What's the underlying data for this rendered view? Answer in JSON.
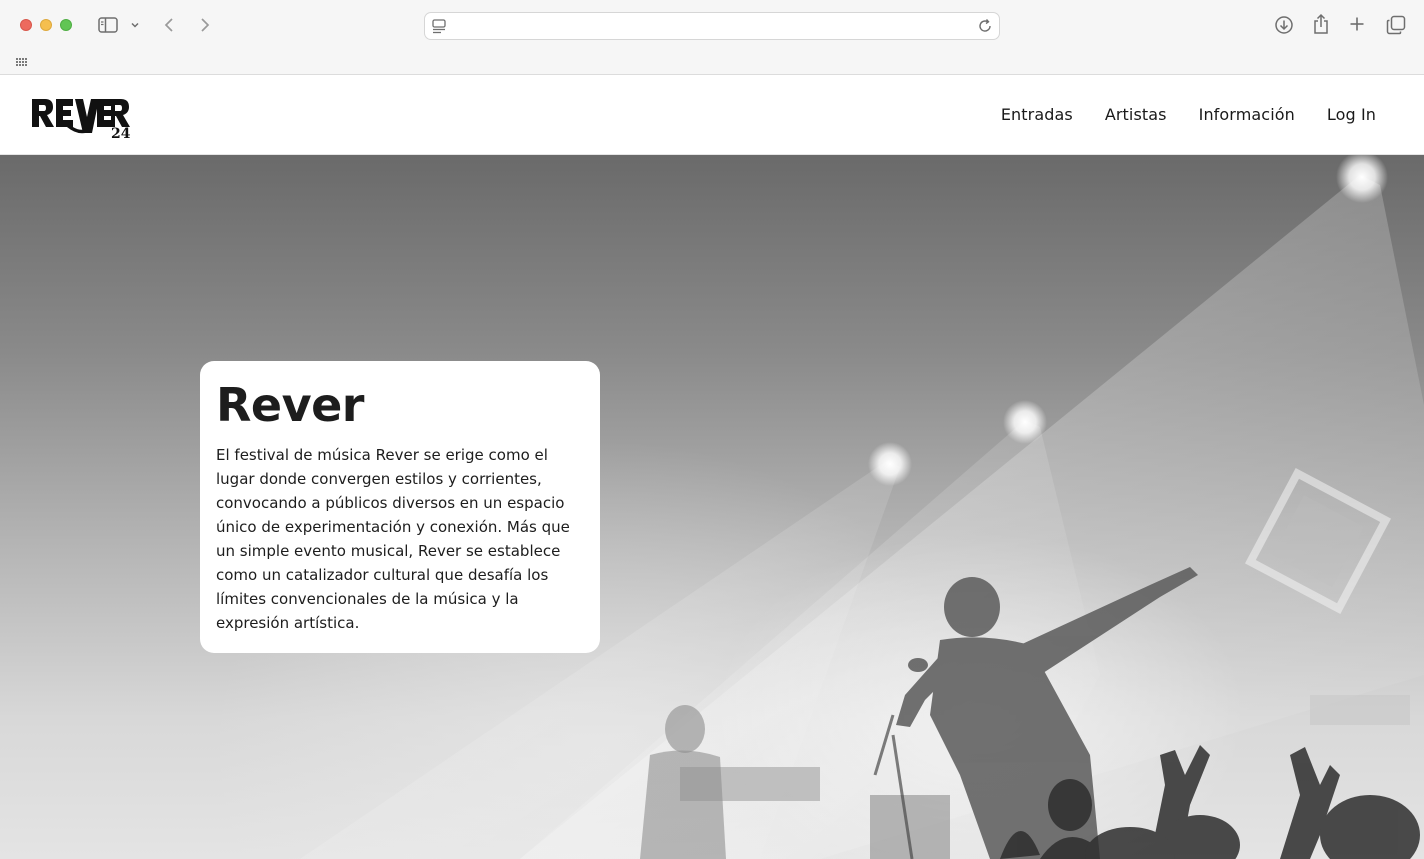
{
  "browser": {
    "icons": {
      "sidebar": "sidebar-icon",
      "chevron": "chevron-down-icon",
      "back": "back-arrow-icon",
      "forward": "forward-arrow-icon",
      "page": "page-icon",
      "reload": "reload-icon",
      "download": "download-icon",
      "share": "share-icon",
      "new_tab": "plus-icon",
      "tabs": "tab-overview-icon",
      "favorites": "grid-icon"
    },
    "colors": {
      "close": "#ed6a5e",
      "minimize": "#f5bf4f",
      "zoom": "#61c554"
    }
  },
  "site": {
    "logo_text": "REVER 24",
    "nav": [
      {
        "label": "Entradas"
      },
      {
        "label": "Artistas"
      },
      {
        "label": "Información"
      },
      {
        "label": "Log In"
      }
    ]
  },
  "hero": {
    "title": "Rever",
    "description": "El festival de música Rever se erige como el lugar donde convergen estilos y corrientes, convocando a públicos diversos en un espacio único de experimentación y conexión. Más que un simple evento musical, Rever se establece como un catalizador cultural que desafía los límites convencionales de la música y la expresión artística.",
    "image": "black-and-white concert photo"
  }
}
